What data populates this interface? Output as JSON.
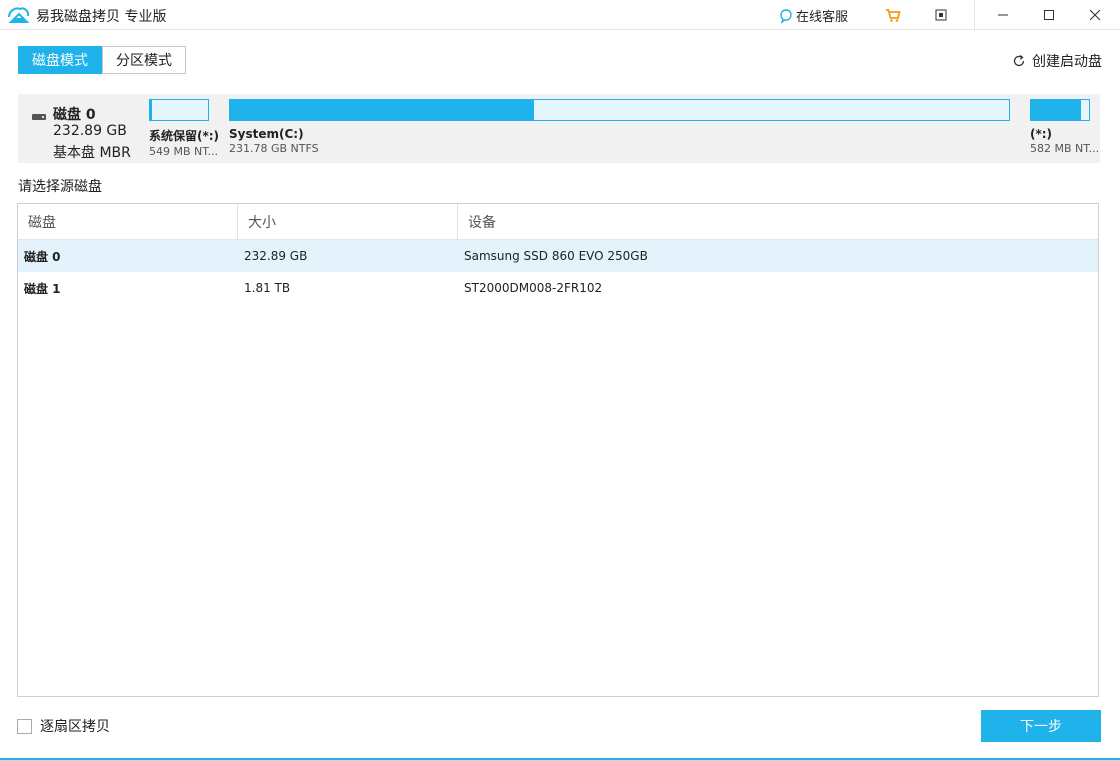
{
  "window": {
    "title": "易我磁盘拷贝 专业版",
    "support_label": "在线客服"
  },
  "modes": {
    "disk_mode": "磁盘模式",
    "partition_mode": "分区模式",
    "active": "disk_mode"
  },
  "boot_disk_label": "创建启动盘",
  "disk": {
    "name": "磁盘 0",
    "size": "232.89 GB",
    "type": "基本盘 MBR",
    "partitions": [
      {
        "label": "系统保留(*:)",
        "detail": "549 MB NT...",
        "used_fraction": 0.03
      },
      {
        "label": "System(C:)",
        "detail": "231.78 GB NTFS",
        "used_fraction": 0.39
      },
      {
        "label": "(*:)",
        "detail": "582 MB NT...",
        "used_fraction": 0.86
      }
    ]
  },
  "prompt": "请选择源磁盘",
  "table": {
    "headers": {
      "disk": "磁盘",
      "size": "大小",
      "device": "设备"
    },
    "rows": [
      {
        "disk": "磁盘 0",
        "size": "232.89 GB",
        "device": "Samsung SSD 860 EVO 250GB"
      },
      {
        "disk": "磁盘 1",
        "size": "1.81 TB",
        "device": "ST2000DM008-2FR102"
      }
    ]
  },
  "footer": {
    "sector_copy_label": "逐扇区拷贝",
    "next_label": "下一步"
  },
  "colors": {
    "accent": "#1fb2eb",
    "selected_row": "#e4f3fb",
    "panel": "#f1f1f1"
  }
}
